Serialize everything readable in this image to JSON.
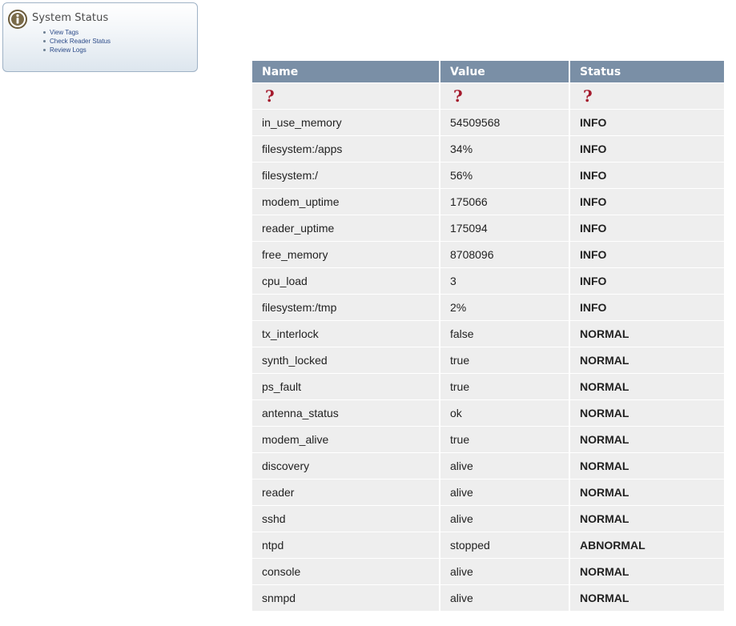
{
  "nav": {
    "title": "System Status",
    "icon": "info-icon",
    "links": [
      {
        "label": "View Tags"
      },
      {
        "label": "Check Reader Status"
      },
      {
        "label": "Review Logs"
      }
    ]
  },
  "table": {
    "headers": [
      "Name",
      "Value",
      "Status"
    ],
    "help_mark": "?",
    "rows": [
      {
        "name": "in_use_memory",
        "value": "54509568",
        "status": "INFO"
      },
      {
        "name": "filesystem:/apps",
        "value": "34%",
        "status": "INFO"
      },
      {
        "name": "filesystem:/",
        "value": "56%",
        "status": "INFO"
      },
      {
        "name": "modem_uptime",
        "value": "175066",
        "status": "INFO"
      },
      {
        "name": "reader_uptime",
        "value": "175094",
        "status": "INFO"
      },
      {
        "name": "free_memory",
        "value": "8708096",
        "status": "INFO"
      },
      {
        "name": "cpu_load",
        "value": "3",
        "status": "INFO"
      },
      {
        "name": "filesystem:/tmp",
        "value": "2%",
        "status": "INFO"
      },
      {
        "name": "tx_interlock",
        "value": "false",
        "status": "NORMAL"
      },
      {
        "name": "synth_locked",
        "value": "true",
        "status": "NORMAL"
      },
      {
        "name": "ps_fault",
        "value": "true",
        "status": "NORMAL"
      },
      {
        "name": "antenna_status",
        "value": "ok",
        "status": "NORMAL"
      },
      {
        "name": "modem_alive",
        "value": "true",
        "status": "NORMAL"
      },
      {
        "name": "discovery",
        "value": "alive",
        "status": "NORMAL"
      },
      {
        "name": "reader",
        "value": "alive",
        "status": "NORMAL"
      },
      {
        "name": "sshd",
        "value": "alive",
        "status": "NORMAL"
      },
      {
        "name": "ntpd",
        "value": "stopped",
        "status": "ABNORMAL"
      },
      {
        "name": "console",
        "value": "alive",
        "status": "NORMAL"
      },
      {
        "name": "snmpd",
        "value": "alive",
        "status": "NORMAL"
      }
    ]
  },
  "colors": {
    "header_bg": "#7a8fa6",
    "row_bg": "#eeeeee",
    "info": "#111111",
    "normal": "#2f9a36",
    "abnormal": "#a4192c"
  }
}
